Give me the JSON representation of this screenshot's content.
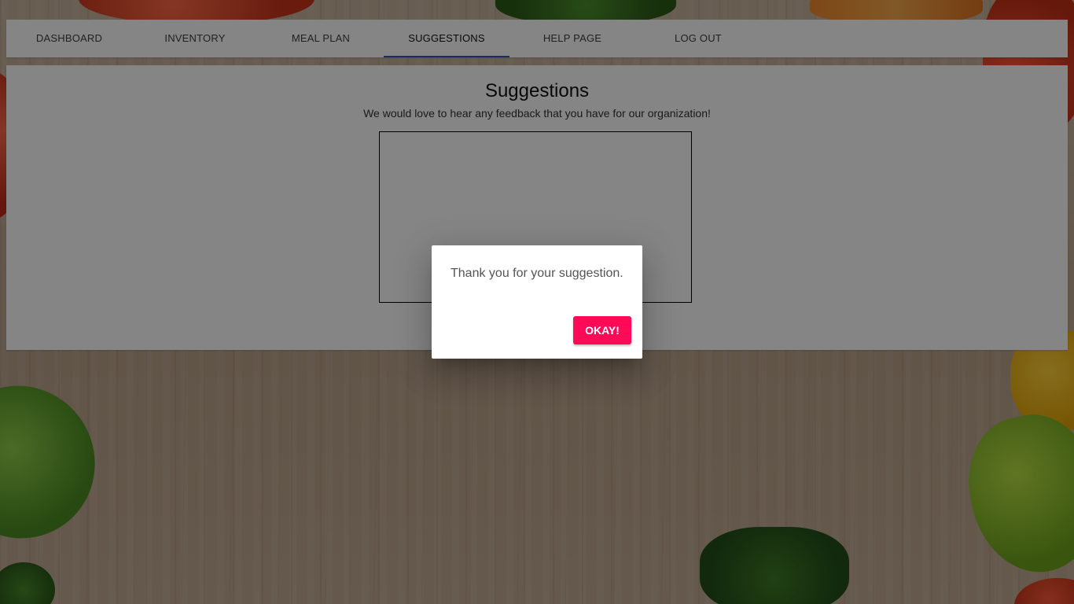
{
  "nav": {
    "tabs": [
      {
        "label": "DASHBOARD",
        "active": false
      },
      {
        "label": "INVENTORY",
        "active": false
      },
      {
        "label": "MEAL PLAN",
        "active": false
      },
      {
        "label": "SUGGESTIONS",
        "active": true
      },
      {
        "label": "HELP PAGE",
        "active": false
      },
      {
        "label": "LOG OUT",
        "active": false
      }
    ],
    "active_indicator_color": "#3f51b5"
  },
  "main": {
    "title": "Suggestions",
    "subtitle": "We would love to hear any feedback that you have for our organization!",
    "suggestion_box": {
      "value": "",
      "placeholder": ""
    }
  },
  "dialog": {
    "message": "Thank you for your suggestion.",
    "ok_label": "OKAY!",
    "ok_color": "#ff0a56"
  },
  "colors": {
    "page_background": "#c2ab94",
    "card_background": "#ffffff",
    "backdrop": "rgba(0,0,0,0.48)"
  }
}
